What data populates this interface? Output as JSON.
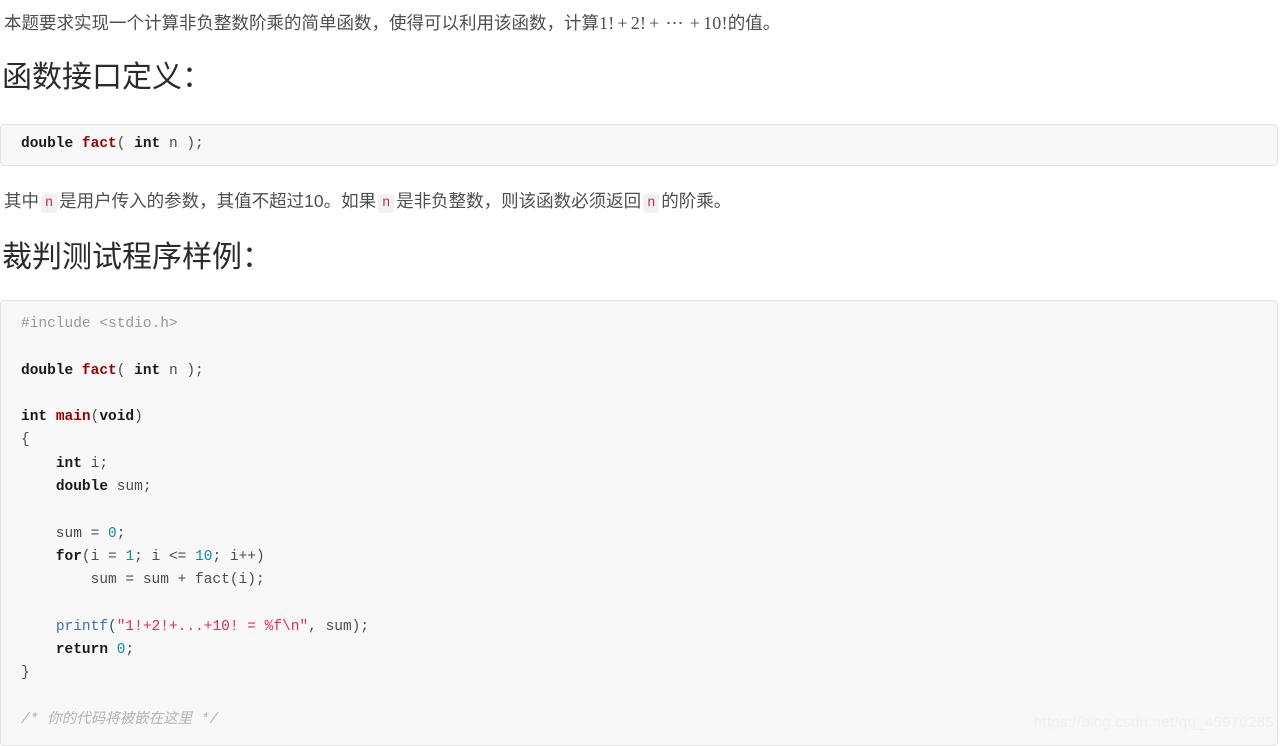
{
  "document": {
    "intro_paragraph": {
      "text_before": "本题要求实现一个计算非负整数阶乘的简单函数，使得可以利用该函数，计算",
      "math": {
        "term1": "1!",
        "plus1": "+",
        "term2": "2!",
        "plus2": "+",
        "ellipsis": "⋯",
        "plus3": "+",
        "term3": "10!"
      },
      "text_after": "的值。"
    },
    "heading_interface": "函数接口定义：",
    "code_signature": {
      "tokens": [
        {
          "t": "double",
          "c": "kw"
        },
        {
          "t": " ",
          "c": "plain"
        },
        {
          "t": "fact",
          "c": "fn-def"
        },
        {
          "t": "( ",
          "c": "plain"
        },
        {
          "t": "int",
          "c": "kw"
        },
        {
          "t": " n );",
          "c": "plain"
        }
      ],
      "plain_text": "double fact( int n );"
    },
    "param_paragraph": {
      "s1": "其中",
      "code1": "n",
      "s2": "是用户传入的参数，其值不超过10。如果",
      "code2": "n",
      "s3": "是非负整数，则该函数必须返回",
      "code3": "n",
      "s4": "的阶乘。"
    },
    "heading_sample": "裁判测试程序样例：",
    "code_sample": {
      "lines": [
        [
          {
            "t": "#include <stdio.h>",
            "c": "pre"
          }
        ],
        [
          {
            "t": "",
            "c": "plain"
          }
        ],
        [
          {
            "t": "double",
            "c": "kw"
          },
          {
            "t": " ",
            "c": "plain"
          },
          {
            "t": "fact",
            "c": "fn-def"
          },
          {
            "t": "( ",
            "c": "plain"
          },
          {
            "t": "int",
            "c": "kw"
          },
          {
            "t": " n );",
            "c": "plain"
          }
        ],
        [
          {
            "t": "",
            "c": "plain"
          }
        ],
        [
          {
            "t": "int",
            "c": "kw"
          },
          {
            "t": " ",
            "c": "plain"
          },
          {
            "t": "main",
            "c": "fn-def"
          },
          {
            "t": "(",
            "c": "plain"
          },
          {
            "t": "void",
            "c": "kw"
          },
          {
            "t": ")",
            "c": "plain"
          }
        ],
        [
          {
            "t": "{",
            "c": "plain"
          }
        ],
        [
          {
            "t": "    ",
            "c": "plain"
          },
          {
            "t": "int",
            "c": "kw"
          },
          {
            "t": " i;",
            "c": "plain"
          }
        ],
        [
          {
            "t": "    ",
            "c": "plain"
          },
          {
            "t": "double",
            "c": "kw"
          },
          {
            "t": " sum;",
            "c": "plain"
          }
        ],
        [
          {
            "t": "",
            "c": "plain"
          }
        ],
        [
          {
            "t": "    sum = ",
            "c": "plain"
          },
          {
            "t": "0",
            "c": "num"
          },
          {
            "t": ";",
            "c": "plain"
          }
        ],
        [
          {
            "t": "    ",
            "c": "plain"
          },
          {
            "t": "for",
            "c": "kw"
          },
          {
            "t": "(i = ",
            "c": "plain"
          },
          {
            "t": "1",
            "c": "num"
          },
          {
            "t": "; i <= ",
            "c": "plain"
          },
          {
            "t": "10",
            "c": "num"
          },
          {
            "t": "; i++)",
            "c": "plain"
          }
        ],
        [
          {
            "t": "        sum = sum + fact(i);",
            "c": "plain"
          }
        ],
        [
          {
            "t": "",
            "c": "plain"
          }
        ],
        [
          {
            "t": "    ",
            "c": "plain"
          },
          {
            "t": "printf",
            "c": "fn"
          },
          {
            "t": "(",
            "c": "plain"
          },
          {
            "t": "\"1!+2!+...+10! = %f\\n\"",
            "c": "str"
          },
          {
            "t": ", sum);",
            "c": "plain"
          }
        ],
        [
          {
            "t": "    ",
            "c": "plain"
          },
          {
            "t": "return",
            "c": "kw"
          },
          {
            "t": " ",
            "c": "plain"
          },
          {
            "t": "0",
            "c": "num"
          },
          {
            "t": ";",
            "c": "plain"
          }
        ],
        [
          {
            "t": "}",
            "c": "plain"
          }
        ],
        [
          {
            "t": "",
            "c": "plain"
          }
        ],
        [
          {
            "t": "/* 你的代码将被嵌在这里 */",
            "c": "comment"
          }
        ]
      ]
    },
    "watermark": "https://blog.csdn.net/qq_45970285"
  },
  "colors": {
    "page_background": "#ffffff",
    "body_text": "#4f4f4f",
    "heading_text": "#2b2b2b",
    "code_background": "#f8f8f8",
    "code_border": "#e3e3e3",
    "keyword": "#1a1a1a",
    "function_definition": "#990000",
    "function_call": "#4271ae",
    "number": "#0b8f94",
    "string": "#e8284f",
    "preprocessor": "#999999",
    "comment": "#b3b3b3",
    "inline_code_text": "#c7254e",
    "inline_code_background": "#f1f1f1",
    "watermark": "#f0f0f0"
  }
}
